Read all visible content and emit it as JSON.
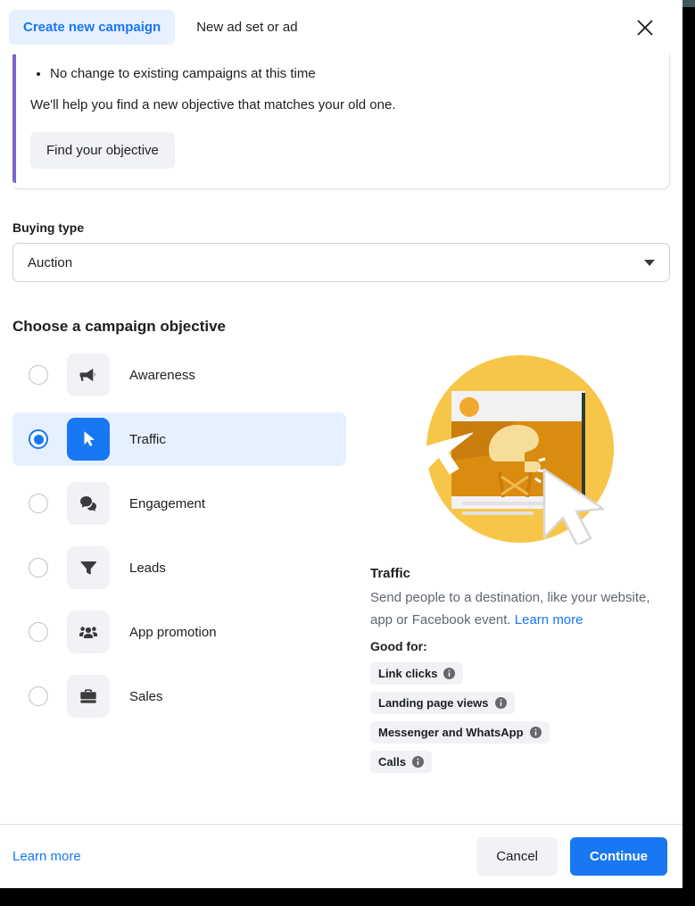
{
  "header": {
    "active_tab": "Create new campaign",
    "inactive_tab": "New ad set or ad",
    "close_icon": "close-icon"
  },
  "notice": {
    "bullets": [
      "No change to existing campaigns at this time"
    ],
    "body": "We'll help you find a new objective that matches your old one.",
    "button": "Find your objective",
    "accent_color": "#7d62d0"
  },
  "buying_type": {
    "label": "Buying type",
    "value": "Auction",
    "caret_icon": "chevron-down-icon"
  },
  "objectives": {
    "title": "Choose a campaign objective",
    "selected": "Traffic",
    "items": [
      {
        "label": "Awareness",
        "icon": "megaphone-icon",
        "selected": false
      },
      {
        "label": "Traffic",
        "icon": "cursor-arrow-icon",
        "selected": true
      },
      {
        "label": "Engagement",
        "icon": "speech-bubbles-icon",
        "selected": false
      },
      {
        "label": "Leads",
        "icon": "funnel-icon",
        "selected": false
      },
      {
        "label": "App promotion",
        "icon": "people-group-icon",
        "selected": false
      },
      {
        "label": "Sales",
        "icon": "briefcase-icon",
        "selected": false
      }
    ]
  },
  "detail_panel": {
    "illustration": "traffic-illustration",
    "title": "Traffic",
    "description": "Send people to a destination, like your website, app or Facebook event.",
    "learn_more": "Learn more",
    "good_for_label": "Good for:",
    "chips": [
      {
        "label": "Link clicks",
        "icon": "info-icon"
      },
      {
        "label": "Landing page views",
        "icon": "info-icon"
      },
      {
        "label": "Messenger and WhatsApp",
        "icon": "info-icon"
      },
      {
        "label": "Calls",
        "icon": "info-icon"
      }
    ]
  },
  "footer": {
    "learn_more": "Learn more",
    "cancel": "Cancel",
    "continue": "Continue"
  },
  "colors": {
    "brand_blue": "#1877f2",
    "selected_row_bg": "#e7f0fe",
    "tile_gray": "#f0f2f5",
    "notice_accent": "#7d62d0"
  }
}
